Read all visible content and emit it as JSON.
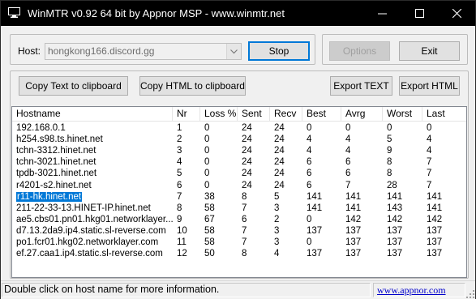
{
  "window": {
    "title": "WinMTR v0.92 64 bit by Appnor MSP - www.winmtr.net"
  },
  "host": {
    "label": "Host:",
    "value": "hongkong166.discord.gg"
  },
  "buttons": {
    "stop": "Stop",
    "options": "Options",
    "exit": "Exit",
    "copy_text": "Copy Text to clipboard",
    "copy_html": "Copy HTML to clipboard",
    "export_text": "Export TEXT",
    "export_html": "Export HTML"
  },
  "table": {
    "columns": [
      "Hostname",
      "Nr",
      "Loss %",
      "Sent",
      "Recv",
      "Best",
      "Avrg",
      "Worst",
      "Last"
    ],
    "rows": [
      [
        "192.168.0.1",
        "1",
        "0",
        "24",
        "24",
        "0",
        "0",
        "0",
        "0"
      ],
      [
        "h254.s98.ts.hinet.net",
        "2",
        "0",
        "24",
        "24",
        "4",
        "4",
        "5",
        "4"
      ],
      [
        "tchn-3312.hinet.net",
        "3",
        "0",
        "24",
        "24",
        "4",
        "4",
        "9",
        "4"
      ],
      [
        "tchn-3021.hinet.net",
        "4",
        "0",
        "24",
        "24",
        "6",
        "6",
        "8",
        "7"
      ],
      [
        "tpdb-3021.hinet.net",
        "5",
        "0",
        "24",
        "24",
        "6",
        "6",
        "8",
        "7"
      ],
      [
        "r4201-s2.hinet.net",
        "6",
        "0",
        "24",
        "24",
        "6",
        "7",
        "28",
        "7"
      ],
      [
        "r11-hk.hinet.net",
        "7",
        "38",
        "8",
        "5",
        "141",
        "141",
        "141",
        "141"
      ],
      [
        "211-22-33-13.HINET-IP.hinet.net",
        "8",
        "58",
        "7",
        "3",
        "141",
        "141",
        "143",
        "141"
      ],
      [
        "ae5.cbs01.pn01.hkg01.networklayer....",
        "9",
        "67",
        "6",
        "2",
        "0",
        "142",
        "142",
        "142"
      ],
      [
        "d7.13.2da9.ip4.static.sl-reverse.com",
        "10",
        "58",
        "7",
        "3",
        "137",
        "137",
        "137",
        "137"
      ],
      [
        "po1.fcr01.hkg02.networklayer.com",
        "11",
        "58",
        "7",
        "3",
        "0",
        "137",
        "137",
        "137"
      ],
      [
        "ef.27.caa1.ip4.static.sl-reverse.com",
        "12",
        "50",
        "8",
        "4",
        "137",
        "137",
        "137",
        "137"
      ]
    ],
    "selected_row": 6
  },
  "statusbar": {
    "message": "Double click on host name for more information.",
    "link": "www.appnor.com"
  },
  "colors": {
    "titlebar": "#000000",
    "selection": "#0078d7",
    "link": "#0000cc"
  }
}
